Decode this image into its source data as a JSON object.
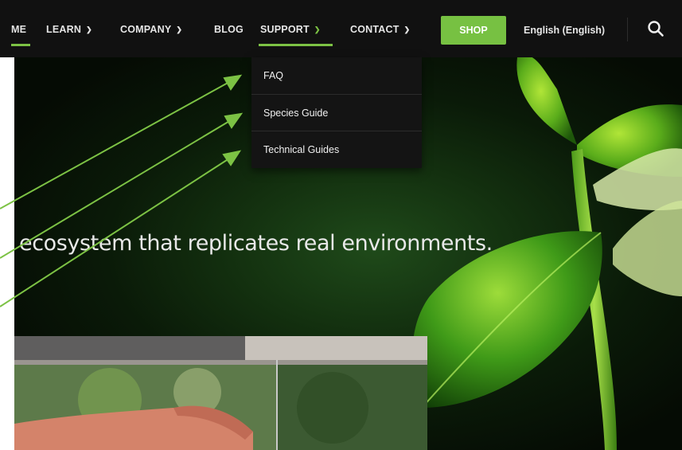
{
  "nav": {
    "items": [
      {
        "label": "ME"
      },
      {
        "label": "LEARN"
      },
      {
        "label": "COMPANY"
      },
      {
        "label": "BLOG"
      },
      {
        "label": "SUPPORT"
      },
      {
        "label": "CONTACT"
      }
    ],
    "shop_label": "SHOP",
    "language_label": "English (English)",
    "search_icon": "search-icon"
  },
  "dropdown": {
    "items": [
      {
        "label": "FAQ"
      },
      {
        "label": "Species Guide"
      },
      {
        "label": "Technical Guides"
      }
    ]
  },
  "hero": {
    "headline": "ecosystem that replicates real environments."
  },
  "colors": {
    "accent_green": "#77c142",
    "nav_bg": "#111111",
    "dropdown_bg": "#141414",
    "arrow_green": "#7cc244"
  }
}
